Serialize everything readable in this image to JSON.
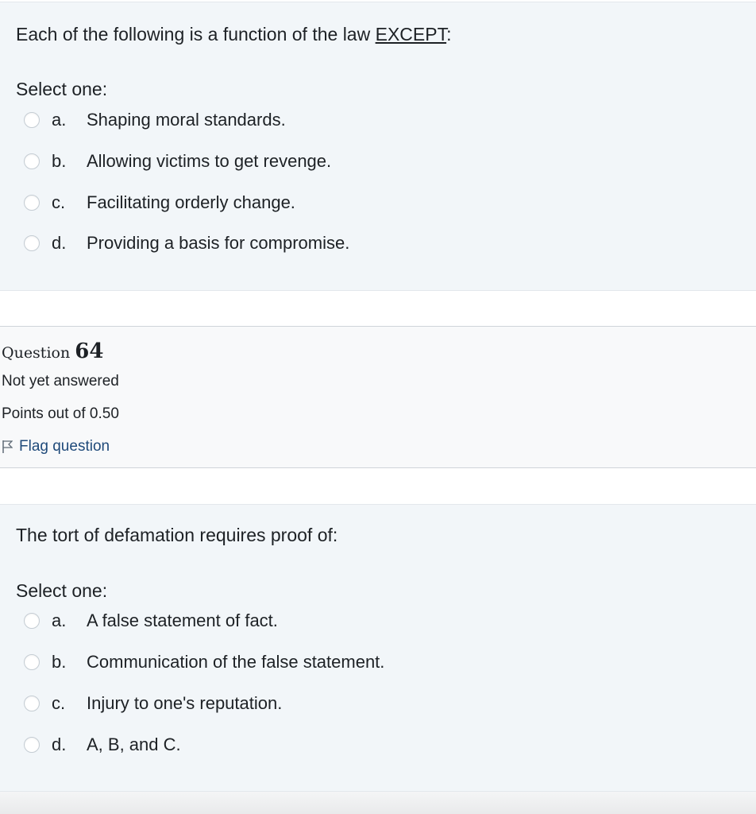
{
  "question63": {
    "text_before": "Each of the following is a function of the law ",
    "text_emph": "EXCEPT",
    "text_after": ":",
    "select_label": "Select one:",
    "options": [
      {
        "letter": "a.",
        "text": "Shaping moral standards."
      },
      {
        "letter": "b.",
        "text": "Allowing victims to get revenge."
      },
      {
        "letter": "c.",
        "text": "Facilitating orderly change."
      },
      {
        "letter": "d.",
        "text": "Providing a basis for compromise."
      }
    ]
  },
  "question64_info": {
    "title_prefix": "Question ",
    "number": "64",
    "status": "Not yet answered",
    "points": "Points out of 0.50",
    "flag_label": "Flag question",
    "flag_icon": "flag-icon"
  },
  "question64": {
    "text": "The tort of defamation requires proof of:",
    "select_label": "Select one:",
    "options": [
      {
        "letter": "a.",
        "text": "A false statement of fact."
      },
      {
        "letter": "b.",
        "text": "Communication of the false statement."
      },
      {
        "letter": "c.",
        "text": "Injury to one's reputation."
      },
      {
        "letter": "d.",
        "text": "A, B, and C."
      }
    ]
  }
}
